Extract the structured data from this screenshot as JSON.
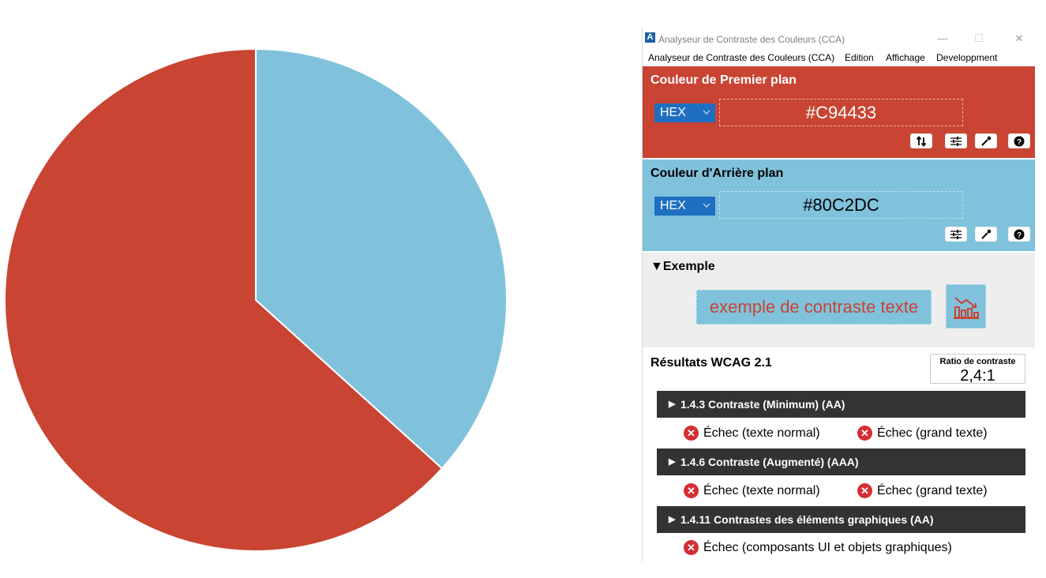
{
  "pie_chart": {
    "slices": [
      {
        "value": 0.367,
        "color": "#80C2DC"
      },
      {
        "value": 0.633,
        "color": "#C94433"
      }
    ]
  },
  "window": {
    "title": "Analyseur de Contraste des Couleurs (CCA)",
    "controls": {
      "minimize": "—",
      "maximize": "☐",
      "close": "✕"
    }
  },
  "menu": {
    "items": [
      "Analyseur de Contraste des Couleurs (CCA)",
      "Edition",
      "Affichage",
      "Developpment"
    ]
  },
  "foreground": {
    "heading": "Couleur de Premier plan",
    "format": "HEX",
    "value": "#C94433",
    "color": "#C94433"
  },
  "background": {
    "heading": "Couleur d'Arrière plan",
    "format": "HEX",
    "value": "#80C2DC",
    "color": "#80C2DC"
  },
  "tool_icons": {
    "foreground": [
      "swap-icon",
      "sliders-icon",
      "eyedropper-icon",
      "help-icon"
    ],
    "background": [
      "sliders-icon",
      "eyedropper-icon",
      "help-icon"
    ]
  },
  "example": {
    "heading": "Exemple",
    "sample_text": "exemple de contraste texte",
    "sample_icon": "chart-icon"
  },
  "results": {
    "heading": "Résultats WCAG 2.1",
    "ratio_label": "Ratio de contraste",
    "ratio_value": "2,4:1",
    "criteria": [
      {
        "label": "1.4.3 Contraste (Minimum) (AA)",
        "results": [
          "Échec (texte normal)",
          "Échec (grand texte)"
        ]
      },
      {
        "label": "1.4.6 Contraste (Augmenté) (AAA)",
        "results": [
          "Échec (texte normal)",
          "Échec (grand texte)"
        ]
      },
      {
        "label": "1.4.11 Contrastes des éléments graphiques (AA)",
        "results": [
          "Échec (composants UI et objets graphiques)"
        ]
      }
    ],
    "fail_color": "#D42E34"
  }
}
